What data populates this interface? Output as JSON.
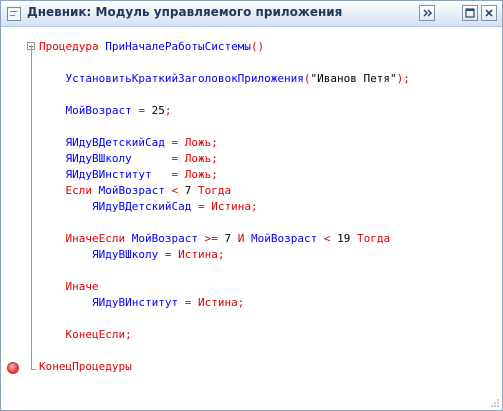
{
  "window": {
    "title": "Дневник: Модуль управляемого приложения",
    "icon": "module-icon",
    "buttons": {
      "more": "more-icon",
      "maximize": "maximize-icon",
      "close": "close-icon"
    }
  },
  "editor": {
    "breakpoint": "breakpoint-icon",
    "lines": [
      [
        {
          "t": "Процедура ",
          "c": "kw"
        },
        {
          "t": "ПриНачалеРаботыСистемы",
          "c": "id"
        },
        {
          "t": "()",
          "c": "punct"
        }
      ],
      [],
      [
        {
          "t": "    ",
          "c": "id"
        },
        {
          "t": "УстановитьКраткийЗаголовокПриложения",
          "c": "id"
        },
        {
          "t": "(",
          "c": "punct"
        },
        {
          "t": "\"Иванов Петя\"",
          "c": "str"
        },
        {
          "t": ");",
          "c": "punct"
        }
      ],
      [],
      [
        {
          "t": "    ",
          "c": "id"
        },
        {
          "t": "МойВозраст ",
          "c": "id"
        },
        {
          "t": "= ",
          "c": "op"
        },
        {
          "t": "25",
          "c": "num"
        },
        {
          "t": ";",
          "c": "punct"
        }
      ],
      [],
      [
        {
          "t": "    ",
          "c": "id"
        },
        {
          "t": "ЯИдуВДетскийСад ",
          "c": "id"
        },
        {
          "t": "= ",
          "c": "op"
        },
        {
          "t": "Ложь",
          "c": "kw"
        },
        {
          "t": ";",
          "c": "punct"
        }
      ],
      [
        {
          "t": "    ",
          "c": "id"
        },
        {
          "t": "ЯИдуВШколу      ",
          "c": "id"
        },
        {
          "t": "= ",
          "c": "op"
        },
        {
          "t": "Ложь",
          "c": "kw"
        },
        {
          "t": ";",
          "c": "punct"
        }
      ],
      [
        {
          "t": "    ",
          "c": "id"
        },
        {
          "t": "ЯИдуВИнститут   ",
          "c": "id"
        },
        {
          "t": "= ",
          "c": "op"
        },
        {
          "t": "Ложь",
          "c": "kw"
        },
        {
          "t": ";",
          "c": "punct"
        }
      ],
      [
        {
          "t": "    ",
          "c": "id"
        },
        {
          "t": "Если ",
          "c": "kw"
        },
        {
          "t": "МойВозраст ",
          "c": "id"
        },
        {
          "t": "< ",
          "c": "op"
        },
        {
          "t": "7 ",
          "c": "num"
        },
        {
          "t": "Тогда",
          "c": "kw"
        }
      ],
      [
        {
          "t": "        ",
          "c": "id"
        },
        {
          "t": "ЯИдуВДетскийСад ",
          "c": "id"
        },
        {
          "t": "= ",
          "c": "op"
        },
        {
          "t": "Истина",
          "c": "kw"
        },
        {
          "t": ";",
          "c": "punct"
        }
      ],
      [],
      [
        {
          "t": "    ",
          "c": "id"
        },
        {
          "t": "ИначеЕсли ",
          "c": "kw"
        },
        {
          "t": "МойВозраст ",
          "c": "id"
        },
        {
          "t": ">= ",
          "c": "op"
        },
        {
          "t": "7 ",
          "c": "num"
        },
        {
          "t": "И ",
          "c": "kw"
        },
        {
          "t": "МойВозраст ",
          "c": "id"
        },
        {
          "t": "< ",
          "c": "op"
        },
        {
          "t": "19 ",
          "c": "num"
        },
        {
          "t": "Тогда",
          "c": "kw"
        }
      ],
      [
        {
          "t": "        ",
          "c": "id"
        },
        {
          "t": "ЯИдуВШколу ",
          "c": "id"
        },
        {
          "t": "= ",
          "c": "op"
        },
        {
          "t": "Истина",
          "c": "kw"
        },
        {
          "t": ";",
          "c": "punct"
        }
      ],
      [],
      [
        {
          "t": "    ",
          "c": "id"
        },
        {
          "t": "Иначе",
          "c": "kw"
        }
      ],
      [
        {
          "t": "        ",
          "c": "id"
        },
        {
          "t": "ЯИдуВИнститут ",
          "c": "id"
        },
        {
          "t": "= ",
          "c": "op"
        },
        {
          "t": "Истина",
          "c": "kw"
        },
        {
          "t": ";",
          "c": "punct"
        }
      ],
      [],
      [
        {
          "t": "    ",
          "c": "id"
        },
        {
          "t": "КонецЕсли",
          "c": "kw"
        },
        {
          "t": ";",
          "c": "punct"
        }
      ],
      [],
      [
        {
          "t": "КонецПроцедуры",
          "c": "kw"
        }
      ]
    ]
  }
}
